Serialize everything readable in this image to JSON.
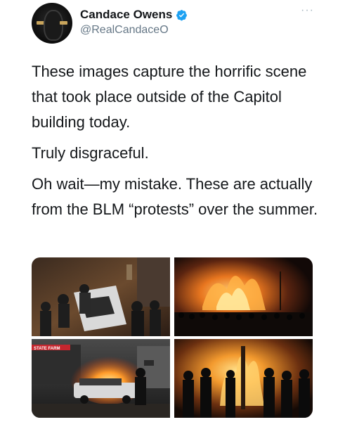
{
  "author": {
    "display_name": "Candace Owens",
    "handle": "@RealCandaceO",
    "verified_icon": "verified-badge-icon",
    "avatar_icon": "profile-avatar"
  },
  "more_label": "···",
  "tweet": {
    "paragraphs": [
      "These images capture the horrific scene that took place outside of the Capitol building today.",
      "Truly disgraceful.",
      "Oh wait—my mistake. These are actually from the BLM “protests” over the summer."
    ]
  },
  "media": {
    "photos": [
      {
        "id": "photo-1",
        "sign_text": ""
      },
      {
        "id": "photo-2",
        "sign_text": ""
      },
      {
        "id": "photo-3",
        "sign_text": "STATE FARM"
      },
      {
        "id": "photo-4",
        "sign_text": ""
      }
    ]
  },
  "colors": {
    "verified_blue": "#1da1f2",
    "text_primary": "#14171a",
    "text_secondary": "#657786"
  }
}
